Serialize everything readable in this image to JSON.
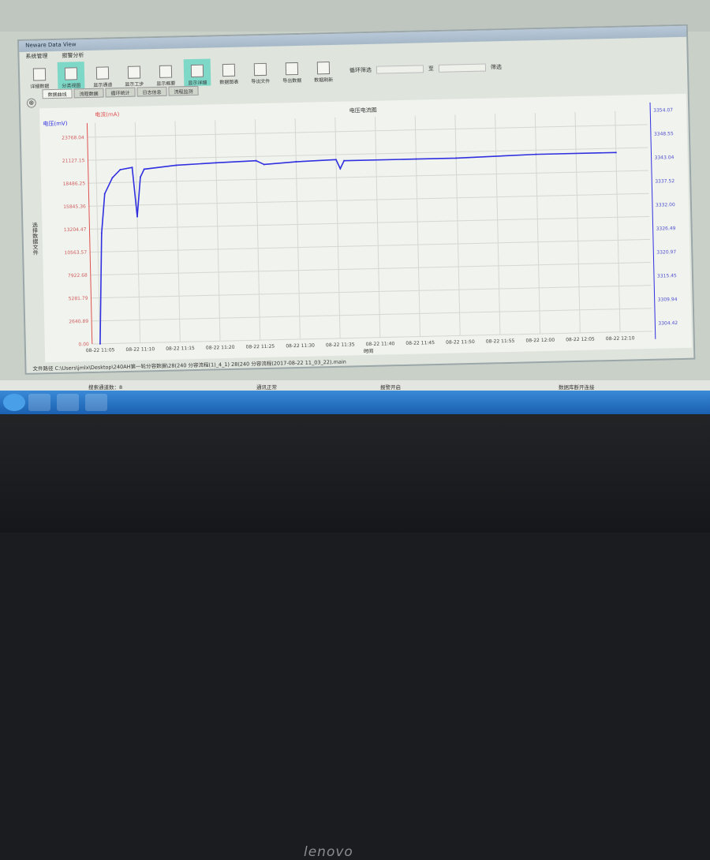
{
  "window": {
    "title": "Neware Data View"
  },
  "menu": [
    "系统管理",
    "报警分析"
  ],
  "toolbar": [
    {
      "label": "详细数据",
      "active": false
    },
    {
      "label": "分类视图",
      "active": true
    },
    {
      "label": "显示通道",
      "active": false
    },
    {
      "label": "显示工步",
      "active": false
    },
    {
      "label": "显示概要",
      "active": false
    },
    {
      "label": "显示详细",
      "active": true
    },
    {
      "label": "数据图表",
      "active": false
    },
    {
      "label": "导出文件",
      "active": false
    },
    {
      "label": "导出数据",
      "active": false
    },
    {
      "label": "数据刷新",
      "active": false
    }
  ],
  "filter": {
    "label": "循环筛选",
    "to": "至",
    "button": "筛选"
  },
  "tabs": [
    {
      "label": "数据曲线",
      "active": true
    },
    {
      "label": "流程数据"
    },
    {
      "label": "循环统计"
    },
    {
      "label": "日志信息"
    },
    {
      "label": "流程监测"
    }
  ],
  "side_label": "选择数据文件",
  "status": {
    "path": "文件路径  C:\\Users\\jmlx\\Desktop\\240AH第一轮分容数据\\28(240 分容流程(1)_4_1) 28(240 分容流程(2017-08-22 11_03_22).main"
  },
  "bottom": {
    "channels": "搜索通道数：8",
    "comm": "通讯正常",
    "alarm": "报警开启",
    "db": "数据库断开连接"
  },
  "brand": "lenovo",
  "chart_data": {
    "type": "line",
    "title": "电压电流图",
    "xlabel": "时间",
    "ylabel_left": "电压(mV)",
    "ylabel_left2": "电流(mA)",
    "left_ticks": [
      "23768.04",
      "21127.15",
      "18486.25",
      "15845.36",
      "13204.47",
      "10563.57",
      "7922.68",
      "5281.79",
      "2640.89",
      "0.00"
    ],
    "right_ticks": [
      "3354.07",
      "3348.55",
      "3343.04",
      "3337.52",
      "3332.00",
      "3326.49",
      "3320.97",
      "3315.45",
      "3309.94",
      "3304.42"
    ],
    "x_ticks": [
      "08-22 11:05",
      "08-22 11:10",
      "08-22 11:15",
      "08-22 11:20",
      "08-22 11:25",
      "08-22 11:30",
      "08-22 11:35",
      "08-22 11:40",
      "08-22 11:45",
      "08-22 11:50",
      "08-22 11:55",
      "08-22 12:00",
      "08-22 12:05",
      "08-22 12:10"
    ],
    "xlim": [
      "11:04",
      "12:14"
    ],
    "ylim_right": [
      3302,
      3356
    ],
    "grid": true,
    "colors": {
      "voltage": "#3030e0",
      "current": "#e05050"
    },
    "series": [
      {
        "axis": "right",
        "x": [
          "11:05",
          "11:05.5",
          "11:06",
          "11:07",
          "11:08",
          "11:09.5",
          "11:10",
          "11:10.5",
          "11:11",
          "11:15",
          "11:20",
          "11:25",
          "11:26",
          "11:30",
          "11:35",
          "11:35.5",
          "11:36",
          "11:45",
          "11:50",
          "12:00",
          "12:10"
        ],
        "values": [
          3302,
          3330,
          3340,
          3344,
          3346,
          3346.5,
          3334,
          3344,
          3346,
          3346.8,
          3347.2,
          3347.5,
          3346.5,
          3347,
          3347.3,
          3345,
          3347,
          3347,
          3347,
          3347.5,
          3347.5
        ]
      }
    ]
  }
}
